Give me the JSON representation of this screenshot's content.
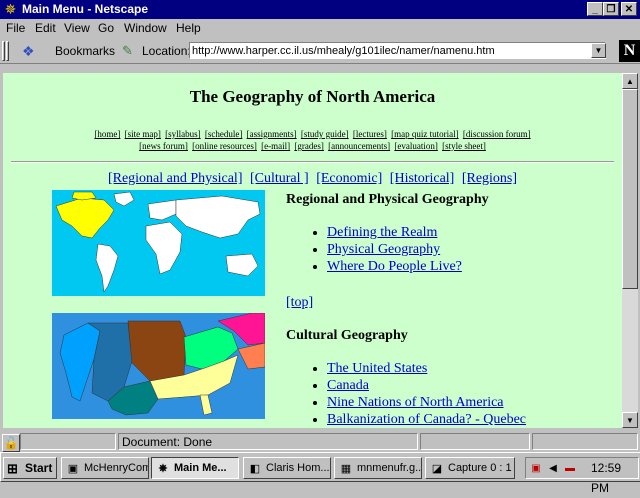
{
  "window": {
    "title": "Main Menu - Netscape"
  },
  "menubar": [
    "File",
    "Edit",
    "View",
    "Go",
    "Window",
    "Help"
  ],
  "toolbar": {
    "bookmarks_label": "Bookmarks",
    "location_label": "Location:",
    "url": "http://www.harper.cc.il.us/mhealy/g101ilec/namer/namenu.htm"
  },
  "page": {
    "title": "The Geography of North America",
    "nav_row1": [
      "[home]",
      "[site map]",
      "[syllabus]",
      "[schedule]",
      "[assignments]",
      "[study guide]",
      "[lectures]",
      "[map quiz tutorial]",
      "[discussion forum]"
    ],
    "nav_row2": [
      "[news forum]",
      "[online resources]",
      "[e-mail]",
      "[grades]",
      "[announcements]",
      "[evaluation]",
      "[style sheet]"
    ],
    "section_nav": [
      "[Regional and Physical]",
      "[Cultural ]",
      "[Economic]",
      "[Historical]",
      "[Regions]"
    ],
    "regional": {
      "heading": "Regional and Physical Geography",
      "links": [
        "Defining the Realm",
        "Physical Geography",
        "Where Do People Live?"
      ]
    },
    "top_link": "[top]",
    "cultural": {
      "heading": "Cultural Geography",
      "links": [
        "The United States",
        "Canada",
        "Nine Nations of North America",
        "Balkanization of Canada? - Quebec"
      ]
    }
  },
  "status": {
    "text": "Document: Done"
  },
  "taskbar": {
    "start": "Start",
    "tasks": [
      "McHenryCom...",
      "Main Me...",
      "Claris Hom...",
      "mnmenufr.g...",
      "Capture 0 : 1"
    ],
    "clock": "12:59 PM"
  },
  "colors": {
    "content_bg": "#ccffcc",
    "link": "#0000cc",
    "titlebar": "#000080"
  }
}
